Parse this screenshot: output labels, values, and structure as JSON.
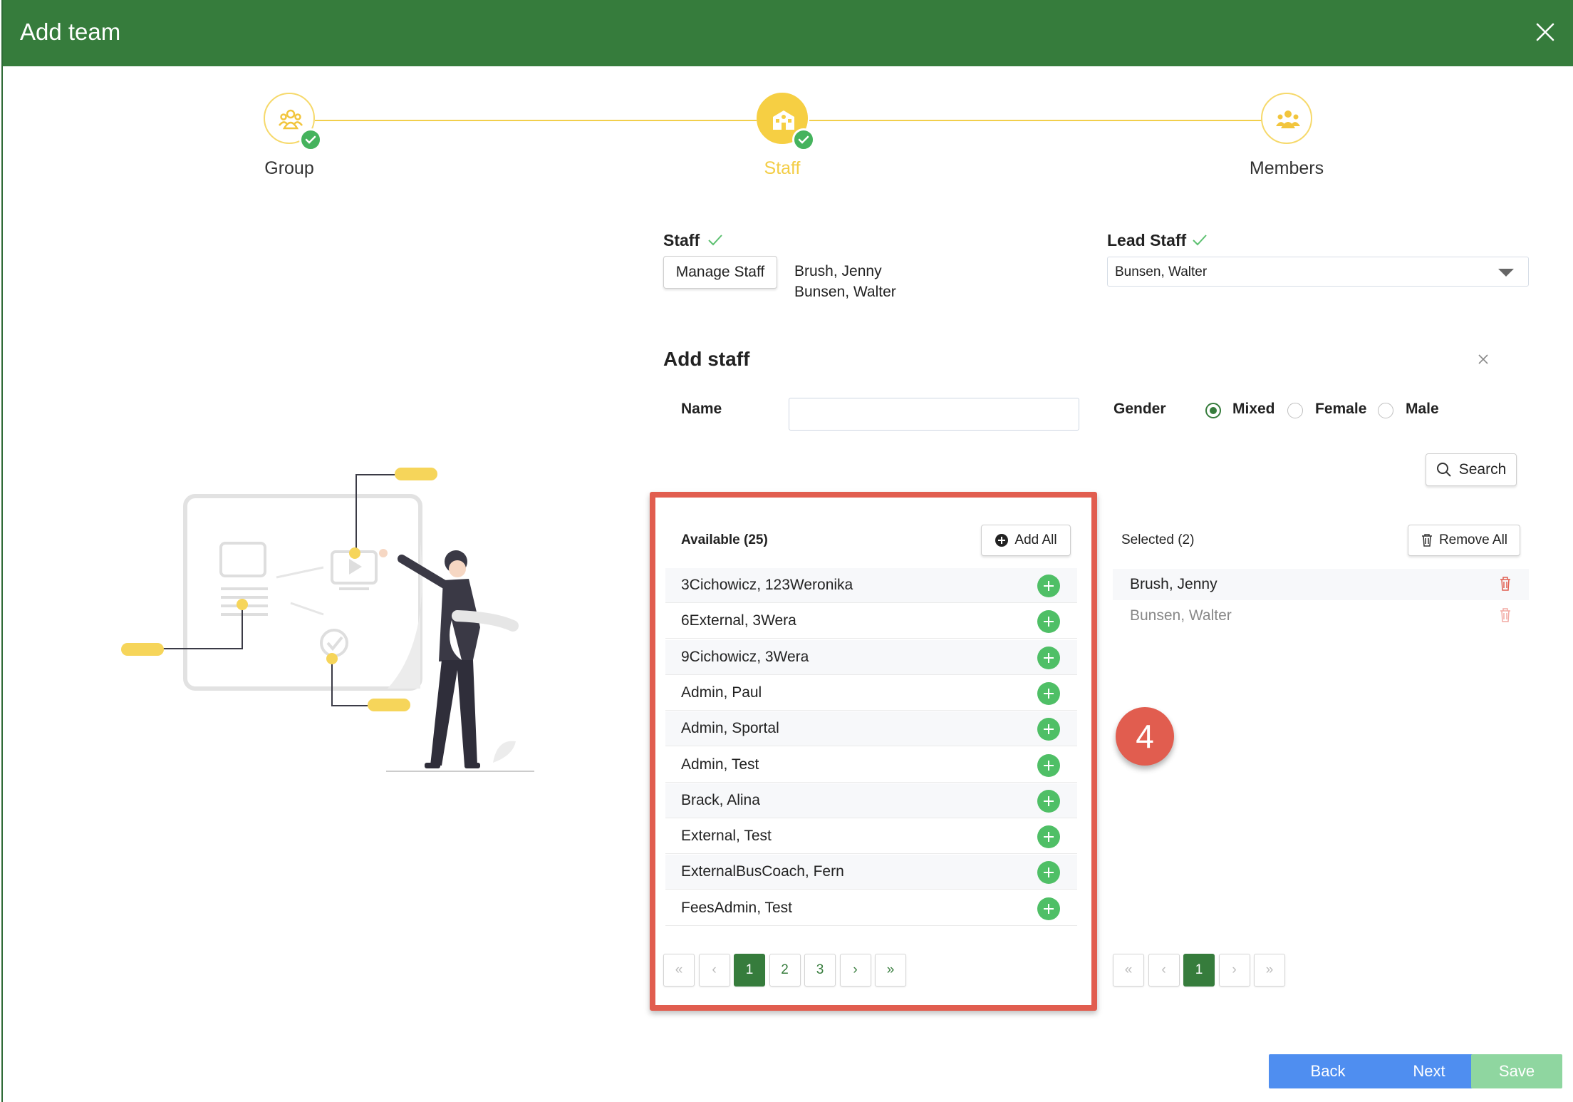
{
  "header": {
    "title": "Add team"
  },
  "stepper": {
    "steps": [
      {
        "label": "Group"
      },
      {
        "label": "Staff"
      },
      {
        "label": "Members"
      }
    ]
  },
  "staff": {
    "label": "Staff",
    "manage_button": "Manage Staff",
    "assigned": [
      "Brush, Jenny",
      "Bunsen, Walter"
    ]
  },
  "lead_staff": {
    "label": "Lead Staff",
    "selected": "Bunsen, Walter"
  },
  "add_staff": {
    "title": "Add staff",
    "name_label": "Name",
    "name_value": "",
    "gender_label": "Gender",
    "gender_options": [
      "Mixed",
      "Female",
      "Male"
    ],
    "gender_selected": "Mixed",
    "search_button": "Search"
  },
  "available": {
    "header": "Available (25)",
    "add_all": "Add All",
    "items": [
      "3Cichowicz, 123Weronika",
      "6External, 3Wera",
      "9Cichowicz, 3Wera",
      "Admin, Paul",
      "Admin, Sportal",
      "Admin, Test",
      "Brack, Alina",
      "External, Test",
      "ExternalBusCoach, Fern",
      "FeesAdmin, Test"
    ],
    "pages": [
      "«",
      "‹",
      "1",
      "2",
      "3",
      "›",
      "»"
    ]
  },
  "selected": {
    "header": "Selected (2)",
    "remove_all": "Remove All",
    "items": [
      "Brush, Jenny",
      "Bunsen, Walter"
    ],
    "pages": [
      "«",
      "‹",
      "1",
      "›",
      "»"
    ]
  },
  "annotation": {
    "number": "4"
  },
  "footer": {
    "back": "Back",
    "next": "Next",
    "save": "Save"
  },
  "colors": {
    "header": "#367c3c",
    "step_accent": "#f6cf43",
    "add_icon": "#4fbf66",
    "highlight": "#e15d4f",
    "primary_button": "#4f8ef0",
    "save_disabled": "#8fd6a0"
  }
}
